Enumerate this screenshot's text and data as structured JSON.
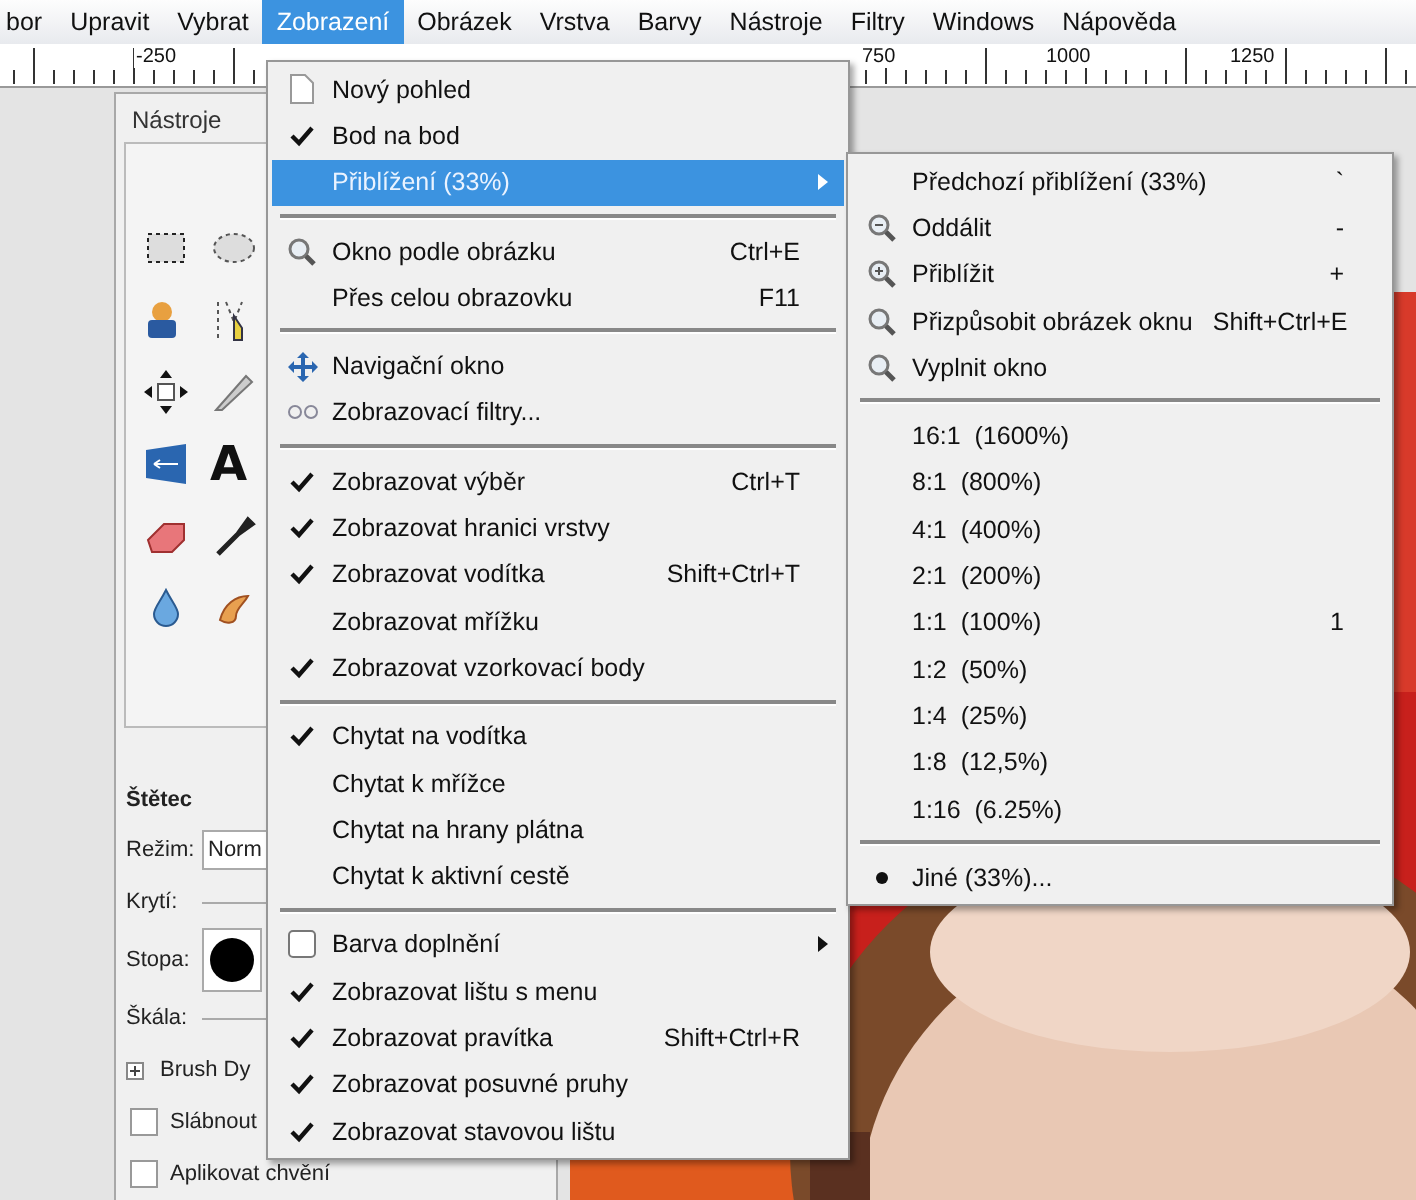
{
  "menubar": [
    {
      "label": "bor",
      "selected": false
    },
    {
      "label": "Upravit",
      "selected": false
    },
    {
      "label": "Vybrat",
      "selected": false
    },
    {
      "label": "Zobrazení",
      "selected": true
    },
    {
      "label": "Obrázek",
      "selected": false
    },
    {
      "label": "Vrstva",
      "selected": false
    },
    {
      "label": "Barvy",
      "selected": false
    },
    {
      "label": "Nástroje",
      "selected": false
    },
    {
      "label": "Filtry",
      "selected": false
    },
    {
      "label": "Windows",
      "selected": false
    },
    {
      "label": "Nápověda",
      "selected": false
    }
  ],
  "ruler": {
    "labels": [
      "-250",
      "750",
      "1000",
      "1250"
    ]
  },
  "toolbox": {
    "title": "Nástroje",
    "tools": [
      {
        "kind": "rect-select"
      },
      {
        "kind": "ellipse-select"
      },
      {
        "kind": "person"
      },
      {
        "kind": "paths"
      },
      {
        "kind": "move"
      },
      {
        "kind": "blade"
      },
      {
        "kind": "flip"
      },
      {
        "kind": "text",
        "glyph": "A"
      },
      {
        "kind": "eraser"
      },
      {
        "kind": "dropper"
      },
      {
        "kind": "drop"
      },
      {
        "kind": "smudge"
      }
    ],
    "options": {
      "title": "Štětec",
      "mode_label": "Režim:",
      "mode_value": "Norm",
      "opacity_label": "Krytí:",
      "brush_label": "Stopa:",
      "scale_label": "Škála:",
      "dynamics": "Brush Dy",
      "checks": [
        {
          "label": "Slábnout",
          "checked": false
        },
        {
          "label": "Aplikovat chvění",
          "checked": false
        }
      ]
    }
  },
  "view_menu": [
    [
      {
        "label": "Nový pohled",
        "kind": "page-icon",
        "selected": false
      },
      {
        "label": "Bod na bod",
        "kind": "toggle",
        "checked": true,
        "selected": false
      },
      {
        "label": "Přiblížení (33%)",
        "kind": "plain",
        "submenu": true,
        "selected": true
      }
    ],
    [
      {
        "label": "Okno podle obrázku",
        "kind": "zoom-icon",
        "shortcut": "Ctrl+E",
        "selected": false
      },
      {
        "label": "Přes celou obrazovku",
        "kind": "plain",
        "shortcut": "F11",
        "selected": false
      }
    ],
    [
      {
        "label": "Navigační okno",
        "kind": "move-icon",
        "selected": false
      },
      {
        "label": "Zobrazovací filtry...",
        "kind": "filter-icon",
        "selected": false
      }
    ],
    [
      {
        "label": "Zobrazovat výběr",
        "kind": "toggle",
        "checked": true,
        "shortcut": "Ctrl+T",
        "selected": false
      },
      {
        "label": "Zobrazovat hranici vrstvy",
        "kind": "toggle",
        "checked": true,
        "selected": false
      },
      {
        "label": "Zobrazovat vodítka",
        "kind": "toggle",
        "checked": true,
        "shortcut": "Shift+Ctrl+T",
        "selected": false
      },
      {
        "label": "Zobrazovat mřížku",
        "kind": "toggle",
        "checked": false,
        "selected": false
      },
      {
        "label": "Zobrazovat vzorkovací body",
        "kind": "toggle",
        "checked": true,
        "selected": false
      }
    ],
    [
      {
        "label": "Chytat na vodítka",
        "kind": "toggle",
        "checked": true,
        "selected": false
      },
      {
        "label": "Chytat k mřížce",
        "kind": "toggle",
        "checked": false,
        "selected": false
      },
      {
        "label": "Chytat na hrany plátna",
        "kind": "toggle",
        "checked": false,
        "selected": false
      },
      {
        "label": "Chytat k aktivní cestě",
        "kind": "toggle",
        "checked": false,
        "selected": false
      }
    ],
    [
      {
        "label": "Barva doplnění",
        "kind": "box",
        "checked": false,
        "submenu": true,
        "selected": false
      },
      {
        "label": "Zobrazovat lištu s menu",
        "kind": "toggle",
        "checked": true,
        "selected": false
      },
      {
        "label": "Zobrazovat pravítka",
        "kind": "toggle",
        "checked": true,
        "shortcut": "Shift+Ctrl+R",
        "selected": false
      },
      {
        "label": "Zobrazovat posuvné pruhy",
        "kind": "toggle",
        "checked": true,
        "selected": false
      },
      {
        "label": "Zobrazovat stavovou lištu",
        "kind": "toggle",
        "checked": true,
        "selected": false
      }
    ]
  ],
  "zoom_menu": [
    [
      {
        "label": "Předchozí přiblížení (33%)",
        "kind": "plain",
        "shortcut": "`"
      },
      {
        "label": "Oddálit",
        "kind": "zoom-out",
        "shortcut": "-"
      },
      {
        "label": "Přiblížit",
        "kind": "zoom-in",
        "shortcut": "+"
      },
      {
        "label": "Přizpůsobit obrázek oknu",
        "kind": "zoom-icon",
        "shortcut": "Shift+Ctrl+E"
      },
      {
        "label": "Vyplnit okno",
        "kind": "zoom-icon"
      }
    ],
    [
      {
        "label": "16:1  (1600%)",
        "kind": "radio",
        "checked": false
      },
      {
        "label": "8:1  (800%)",
        "kind": "radio",
        "checked": false
      },
      {
        "label": "4:1  (400%)",
        "kind": "radio",
        "checked": false
      },
      {
        "label": "2:1  (200%)",
        "kind": "radio",
        "checked": false
      },
      {
        "label": "1:1  (100%)",
        "kind": "radio",
        "checked": false,
        "shortcut": "1"
      },
      {
        "label": "1:2  (50%)",
        "kind": "radio",
        "checked": false
      },
      {
        "label": "1:4  (25%)",
        "kind": "radio",
        "checked": false
      },
      {
        "label": "1:8  (12,5%)",
        "kind": "radio",
        "checked": false
      },
      {
        "label": "1:16  (6.25%)",
        "kind": "radio",
        "checked": false
      }
    ],
    [
      {
        "label": "Jiné (33%)...",
        "kind": "radio",
        "checked": true
      }
    ]
  ]
}
